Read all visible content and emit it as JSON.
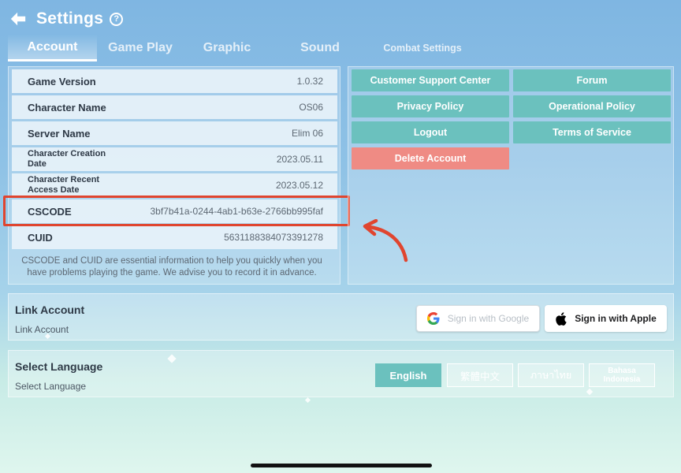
{
  "header": {
    "title": "Settings",
    "help_glyph": "?",
    "back_icon": "arrow-left-icon"
  },
  "tabs": [
    {
      "label": "Account",
      "active": true
    },
    {
      "label": "Game Play",
      "active": false
    },
    {
      "label": "Graphic",
      "active": false
    },
    {
      "label": "Sound",
      "active": false
    },
    {
      "label": "Combat Settings",
      "active": false
    }
  ],
  "account_info": {
    "rows": [
      {
        "label": "Game Version",
        "value": "1.0.32"
      },
      {
        "label": "Character Name",
        "value": "OS06"
      },
      {
        "label": "Server Name",
        "value": "Elim 06"
      },
      {
        "label": "Character Creation Date",
        "value": "2023.05.11"
      },
      {
        "label": "Character Recent Access Date",
        "value": "2023.05.12"
      },
      {
        "label": "CSCODE",
        "value": "3bf7b41a-0244-4ab1-b63e-2766bb995faf"
      },
      {
        "label": "CUID",
        "value": "5631188384073391278"
      }
    ],
    "note": "CSCODE and CUID are essential information to help you quickly when you have problems playing the game. We advise you to record it in advance."
  },
  "actions": {
    "customer_support": "Customer Support Center",
    "forum": "Forum",
    "privacy_policy": "Privacy Policy",
    "operational_policy": "Operational Policy",
    "logout": "Logout",
    "terms_of_service": "Terms of Service",
    "delete_account": "Delete Account"
  },
  "link_account": {
    "title": "Link Account",
    "subtitle": "Link Account",
    "google_label": "Sign in with Google",
    "apple_label": "Sign in with Apple",
    "google_icon": "google-icon",
    "apple_icon": "apple-icon"
  },
  "language": {
    "title": "Select Language",
    "subtitle": "Select Language",
    "options": [
      "English",
      "繁體中文",
      "ภาษาไทย",
      "Bahasa Indonesia"
    ],
    "selected": "English"
  },
  "colors": {
    "accent_teal": "#6bc1be",
    "danger_pink": "#ef8b84",
    "highlight_red": "#e0452f",
    "arrow_red": "#e0452f"
  }
}
